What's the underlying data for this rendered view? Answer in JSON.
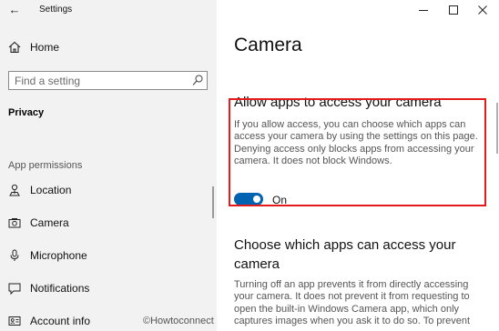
{
  "window": {
    "title": "Settings",
    "back_glyph": "←",
    "controls": {
      "minimize": "—",
      "maximize": "□",
      "close": "✕"
    }
  },
  "sidebar": {
    "home_label": "Home",
    "search_placeholder": "Find a setting",
    "section_title": "Privacy",
    "group_label": "App permissions",
    "items": [
      {
        "label": "Location",
        "icon": "location-icon"
      },
      {
        "label": "Camera",
        "icon": "camera-icon"
      },
      {
        "label": "Microphone",
        "icon": "microphone-icon"
      },
      {
        "label": "Notifications",
        "icon": "notifications-icon"
      },
      {
        "label": "Account info",
        "icon": "account-info-icon"
      }
    ],
    "watermark": "©Howtoconnect"
  },
  "main": {
    "page_title": "Camera",
    "allow_heading": "Allow apps to access your camera",
    "allow_description": "If you allow access, you can choose which apps can access your camera by using the settings on this page. Denying access only blocks apps from accessing your camera. It does not block Windows.",
    "toggle": {
      "state": "On",
      "on": true
    },
    "choose_heading": "Choose which apps can access your camera",
    "choose_description": "Turning off an app prevents it from directly accessing your camera. It does not prevent it from requesting to open the built-in Windows Camera app, which only captures images when you ask it to do so. To prevent"
  },
  "colors": {
    "accent": "#0063b1",
    "highlight": "#e31b1b",
    "sidebar_bg": "#f2f2f2"
  }
}
